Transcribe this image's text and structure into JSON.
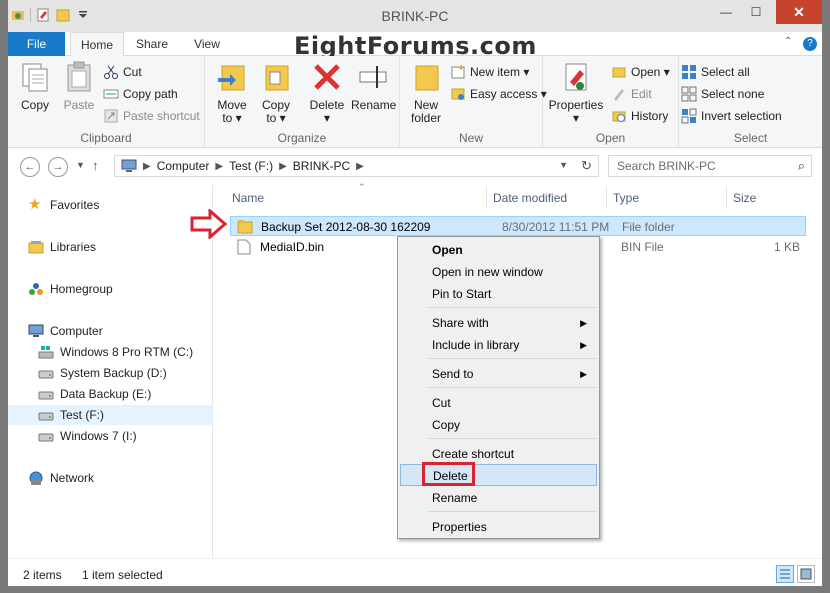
{
  "window": {
    "title": "BRINK-PC",
    "close_glyph": "✕",
    "min_glyph": "—",
    "max_glyph": "☐"
  },
  "watermark": "EightForums.com",
  "tabs": [
    {
      "label": "File"
    },
    {
      "label": "Home"
    },
    {
      "label": "Share"
    },
    {
      "label": "View"
    }
  ],
  "ribbon": {
    "clipboard": {
      "label": "Clipboard",
      "copy": "Copy",
      "paste": "Paste",
      "cut": "Cut",
      "copy_path": "Copy path",
      "paste_shortcut": "Paste shortcut"
    },
    "organize": {
      "label": "Organize",
      "move_to": "Move",
      "move_to_2": "to ▾",
      "copy_to": "Copy",
      "copy_to_2": "to ▾",
      "delete": "Delete",
      "delete_2": "▾",
      "rename": "Rename"
    },
    "new": {
      "label": "New",
      "new_folder": "New",
      "new_folder_2": "folder",
      "new_item": "New item ▾",
      "easy_access": "Easy access ▾"
    },
    "open": {
      "label": "Open",
      "properties": "Properties",
      "properties_2": "▾",
      "open": "Open ▾",
      "edit": "Edit",
      "history": "History"
    },
    "select": {
      "label": "Select",
      "select_all": "Select all",
      "select_none": "Select none",
      "invert": "Invert selection"
    }
  },
  "address": {
    "crumbs": [
      "Computer",
      "Test (F:)",
      "BRINK-PC"
    ],
    "search_placeholder": "Search BRINK-PC"
  },
  "nav": {
    "favorites": "Favorites",
    "libraries": "Libraries",
    "homegroup": "Homegroup",
    "computer": "Computer",
    "drives": [
      "Windows 8 Pro RTM (C:)",
      "System Backup (D:)",
      "Data Backup (E:)",
      "Test (F:)",
      "Windows 7 (I:)"
    ],
    "network": "Network"
  },
  "columns": {
    "name": "Name",
    "date": "Date modified",
    "type": "Type",
    "size": "Size"
  },
  "files": [
    {
      "name": "Backup Set 2012-08-30 162209",
      "date": "8/30/2012 11:51 PM",
      "type": "File folder",
      "size": ""
    },
    {
      "name": "MediaID.bin",
      "date": "",
      "type": "BIN File",
      "size": "1 KB"
    }
  ],
  "context_menu": {
    "open": "Open",
    "open_new_window": "Open in new window",
    "pin_to_start": "Pin to Start",
    "share_with": "Share with",
    "include_in_library": "Include in library",
    "send_to": "Send to",
    "cut": "Cut",
    "copy": "Copy",
    "create_shortcut": "Create shortcut",
    "delete": "Delete",
    "rename": "Rename",
    "properties": "Properties",
    "submenu_arrow": "▶"
  },
  "status": {
    "items": "2 items",
    "selected": "1 item selected"
  },
  "colors": {
    "accent": "#1979ca",
    "close_red": "#c7432b",
    "selection": "#cce8ff",
    "highlight_red": "#d9232e"
  }
}
